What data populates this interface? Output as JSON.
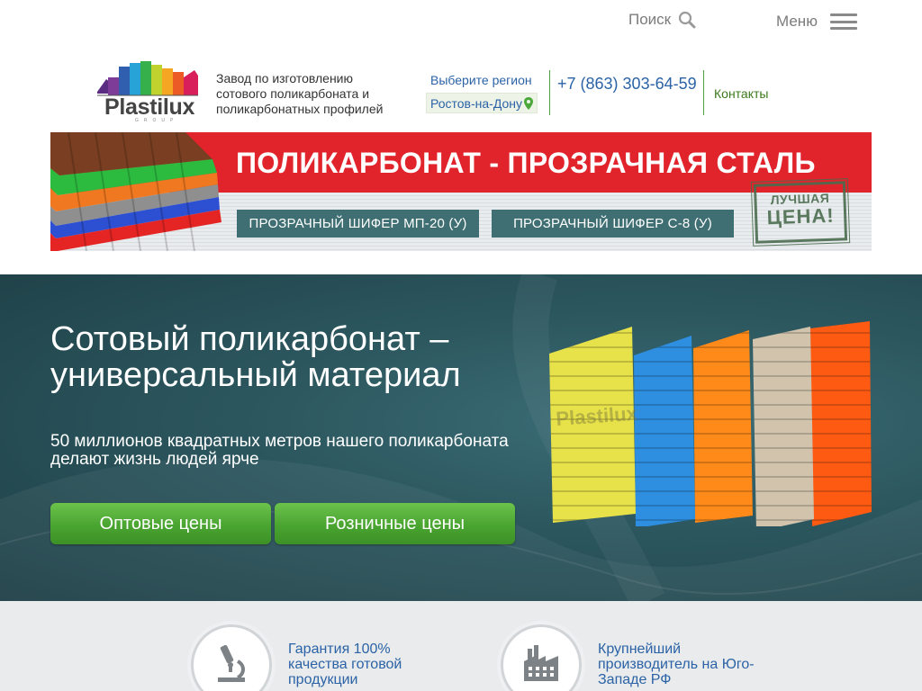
{
  "topbar": {
    "search_label": "Поиск",
    "menu_label": "Меню"
  },
  "header": {
    "logo_text": "Plastilux",
    "logo_sub": "GROUP",
    "tagline": "Завод по изготовлению сотового поликарбоната и поликарбонатных профилей",
    "region_label": "Выберите регион",
    "region_value": "Ростов-на-Дону",
    "phone": "+7 (863) 303-64-59",
    "contacts_label": "Контакты"
  },
  "promo": {
    "title": "ПОЛИКАРБОНАТ - ПРОЗРАЧНАЯ СТАЛЬ",
    "buttons": [
      "ПРОЗРАЧНЫЙ ШИФЕР МП-20 (У)",
      "ПРОЗРАЧНЫЙ ШИФЕР С-8 (У)"
    ],
    "stamp_line1": "ЛУЧШАЯ",
    "stamp_line2": "ЦЕНА!"
  },
  "hero": {
    "title": "Сотовый поликарбонат – универсальный материал",
    "subtitle": "50 миллионов квадратных метров нашего поликарбоната делают жизнь людей ярче",
    "panel_brand": "Plastilux",
    "buttons": [
      "Оптовые цены",
      "Розничные цены"
    ]
  },
  "features": [
    {
      "icon": "microscope-icon",
      "text": "Гарантия 100% качества готовой продукции"
    },
    {
      "icon": "factory-icon",
      "text": "Крупнейший производитель на Юго-Западе РФ"
    }
  ],
  "colors": {
    "accent_blue": "#2b63a6",
    "brand_green": "#4aa83a",
    "promo_red": "#e1232b",
    "promo_teal": "#3f6f73",
    "hero_bg": "#2d5860"
  }
}
